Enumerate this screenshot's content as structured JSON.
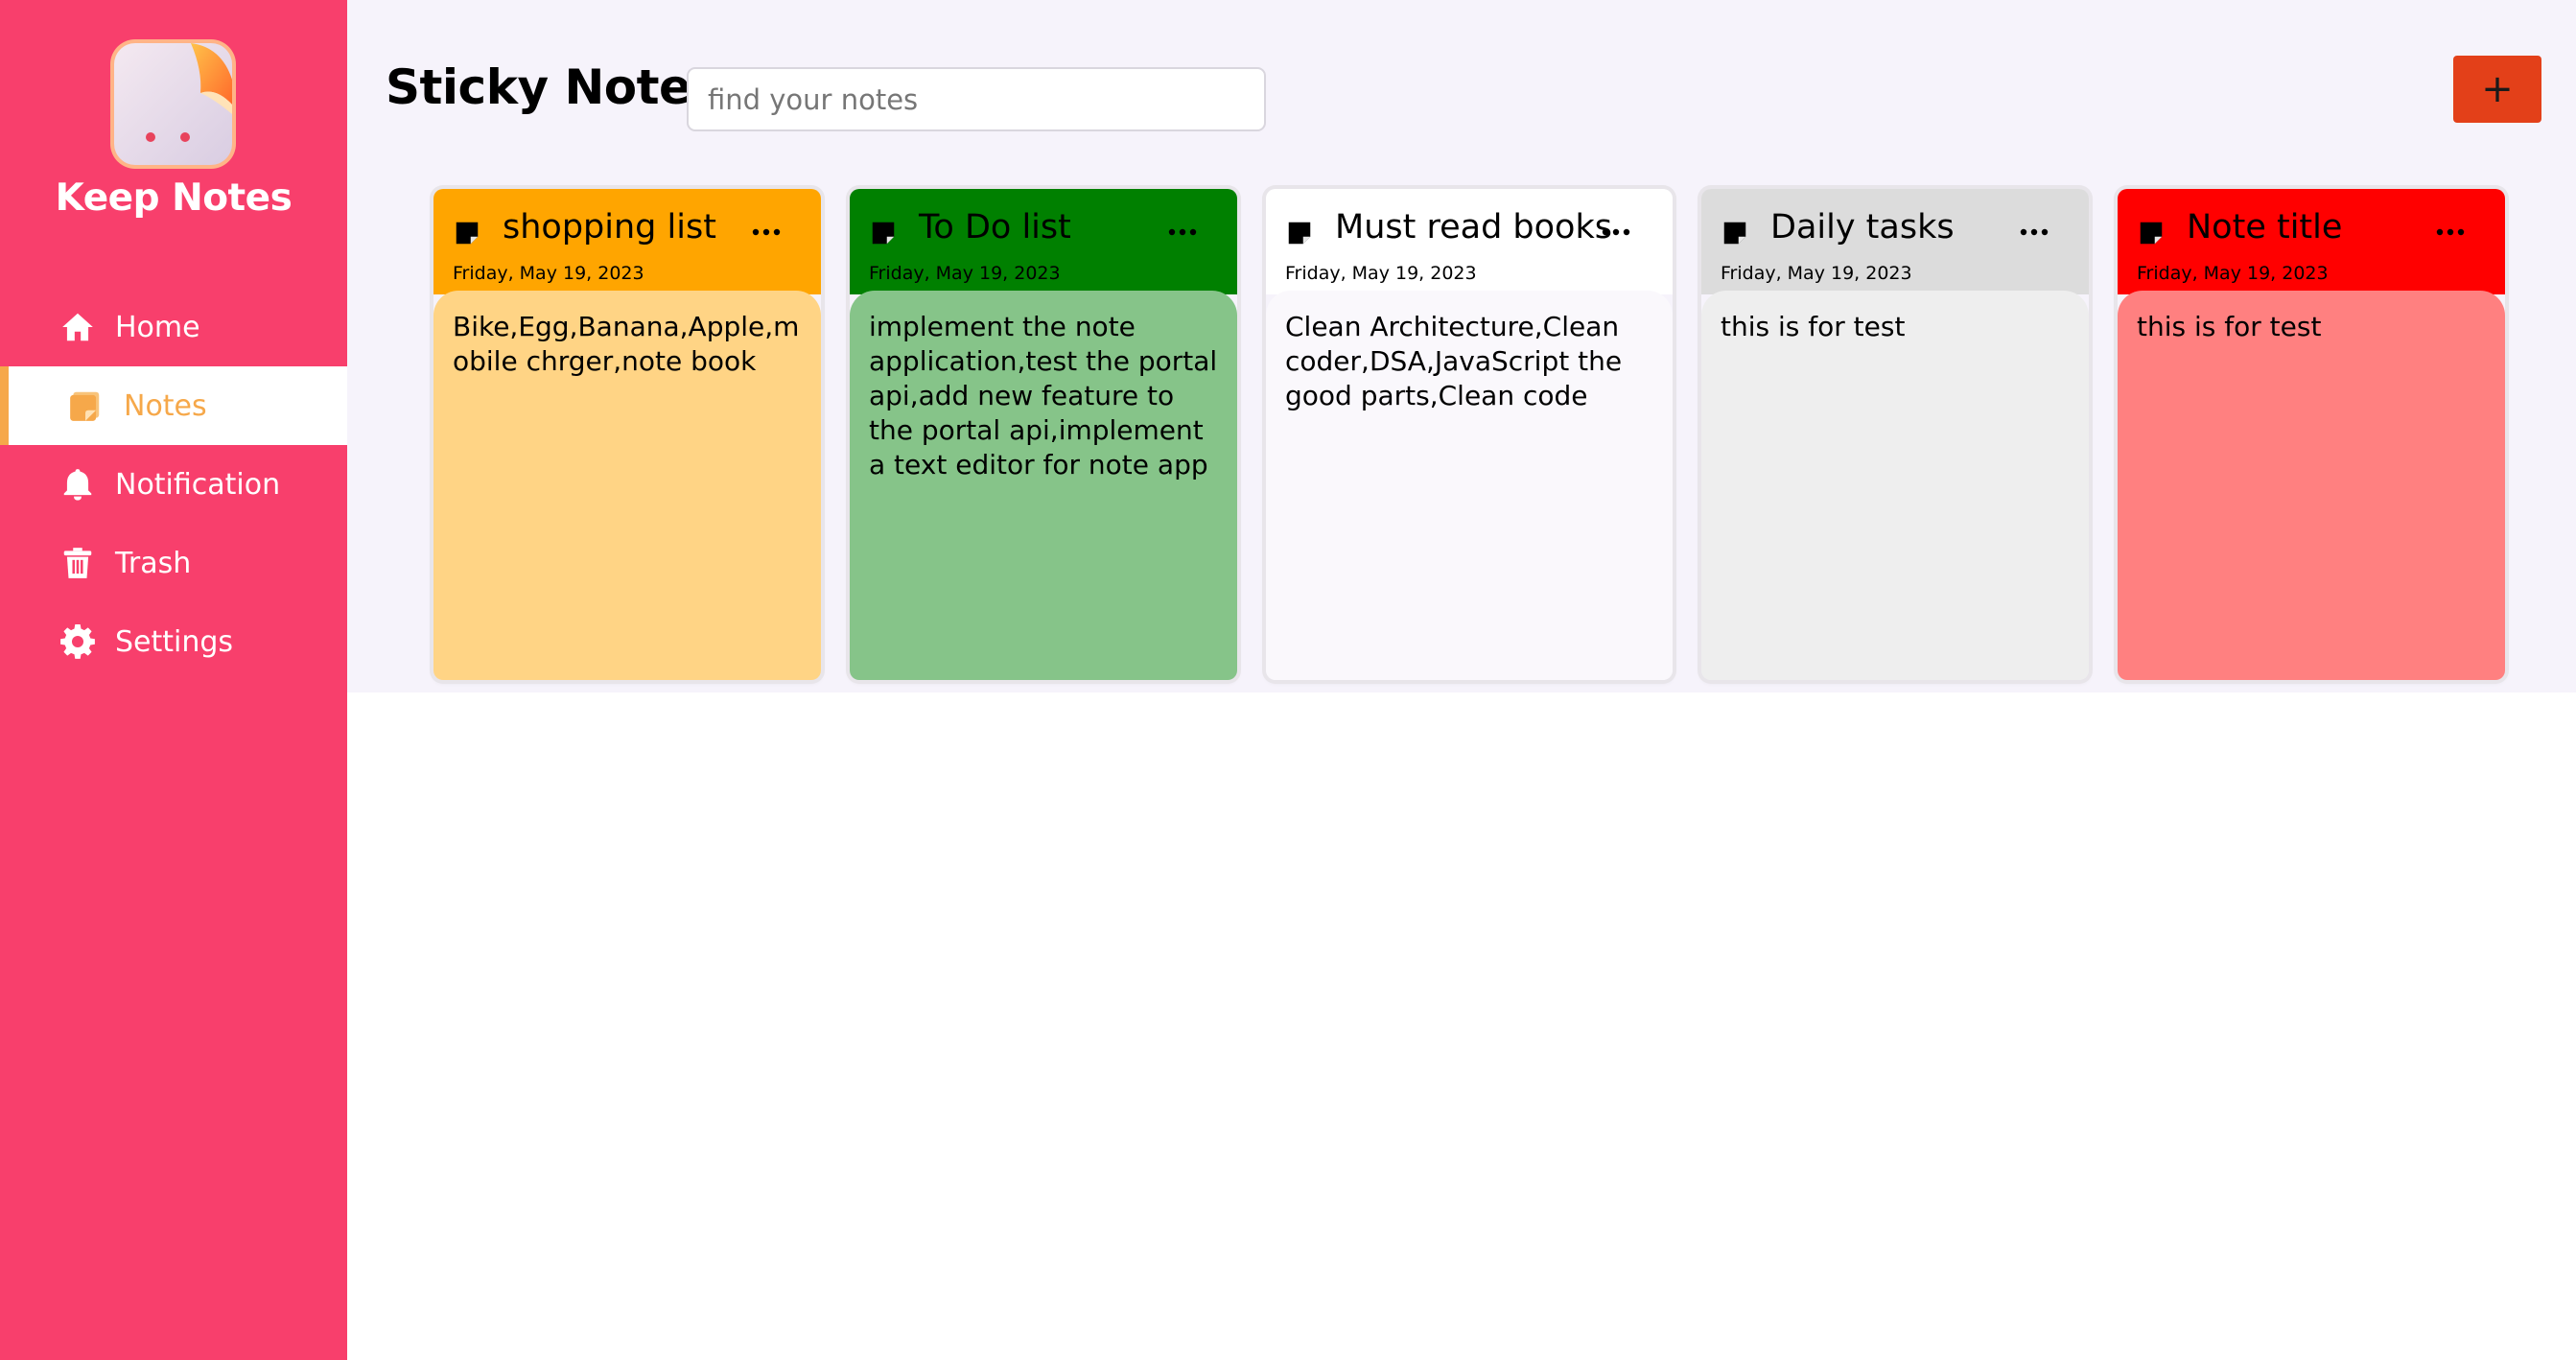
{
  "app": {
    "brand": "Keep Notes"
  },
  "sidebar": {
    "items": [
      {
        "label": "Home",
        "icon": "home-icon"
      },
      {
        "label": "Notes",
        "icon": "note-icon",
        "active": true
      },
      {
        "label": "Notification",
        "icon": "bell-icon"
      },
      {
        "label": "Trash",
        "icon": "trash-icon"
      },
      {
        "label": "Settings",
        "icon": "gear-icon"
      }
    ]
  },
  "header": {
    "title": "Sticky Note",
    "search_placeholder": "find your notes",
    "search_value": "",
    "add_button_label": "+"
  },
  "notes": [
    {
      "title": "shopping list",
      "date": "Friday, May 19, 2023",
      "body": "Bike,Egg,Banana,Apple,mobile chrger,note book",
      "header_color": "#ffa500",
      "body_color": "#ffd485"
    },
    {
      "title": "To Do list",
      "date": "Friday, May 19, 2023",
      "body": "implement the note application,test the portal api,add new feature to the portal api,implement a text editor for note app",
      "header_color": "#008000",
      "body_color": "#86c489"
    },
    {
      "title": "Must read books",
      "date": "Friday, May 19, 2023",
      "body": "Clean Architecture,Clean coder,DSA,JavaScript the good parts,Clean code",
      "header_color": "#ffffff",
      "body_color": "#faf8fc"
    },
    {
      "title": "Daily tasks",
      "date": "Friday, May 19, 2023",
      "body": "this is for test",
      "header_color": "#dcdcdc",
      "body_color": "#eeeeee"
    },
    {
      "title": "Note title",
      "date": "Friday, May 19, 2023",
      "body": "this is for test",
      "header_color": "#ff0000",
      "body_color": "#ff8080"
    }
  ],
  "colors": {
    "sidebar": "#f83f6c",
    "accent": "#f6a84a",
    "add_button": "#e34019",
    "header_band": "#f6f3fb"
  }
}
